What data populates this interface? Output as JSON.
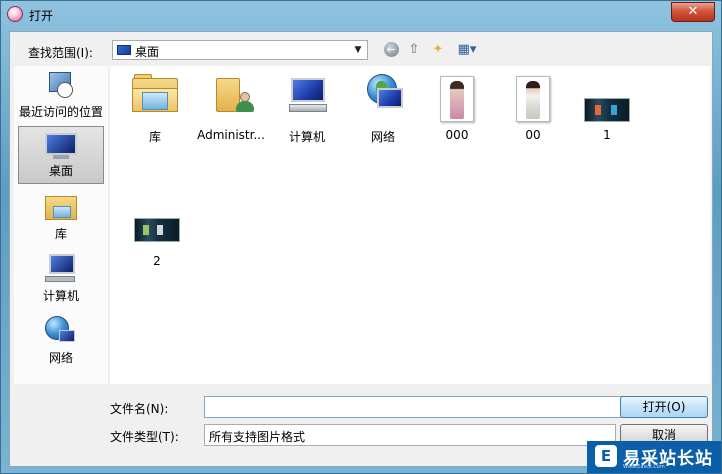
{
  "window": {
    "title": "打开",
    "close_glyph": "✕"
  },
  "lookin": {
    "label": "查找范围(I):",
    "value": "桌面"
  },
  "toolbar": {
    "back_glyph": "←",
    "up_glyph": "⇧",
    "newfolder_glyph": "✦",
    "view_glyph": "▦▾"
  },
  "places": [
    {
      "label": "最近访问的位置",
      "icon": "recent-icon"
    },
    {
      "label": "桌面",
      "icon": "desktop-icon",
      "selected": true
    },
    {
      "label": "库",
      "icon": "library-icon"
    },
    {
      "label": "计算机",
      "icon": "computer-icon"
    },
    {
      "label": "网络",
      "icon": "network-icon"
    }
  ],
  "files": [
    {
      "label": "库",
      "icon": "library-folder-icon"
    },
    {
      "label": "Administr...",
      "icon": "user-folder-icon"
    },
    {
      "label": "计算机",
      "icon": "computer-icon"
    },
    {
      "label": "网络",
      "icon": "network-icon"
    },
    {
      "label": "000",
      "icon": "image-thumbnail-icon"
    },
    {
      "label": "00",
      "icon": "image-thumbnail-icon"
    },
    {
      "label": "1",
      "icon": "image-thumbnail-icon"
    },
    {
      "label": "2",
      "icon": "image-thumbnail-icon"
    }
  ],
  "filename": {
    "label": "文件名(N):",
    "value": "",
    "placeholder": ""
  },
  "filetype": {
    "label": "文件类型(T):",
    "value": "所有支持图片格式"
  },
  "buttons": {
    "open": "打开(O)",
    "cancel": "取消"
  },
  "watermark": {
    "logo": "E",
    "name": "易采站长站",
    "url": "Www.Easck.Com"
  }
}
